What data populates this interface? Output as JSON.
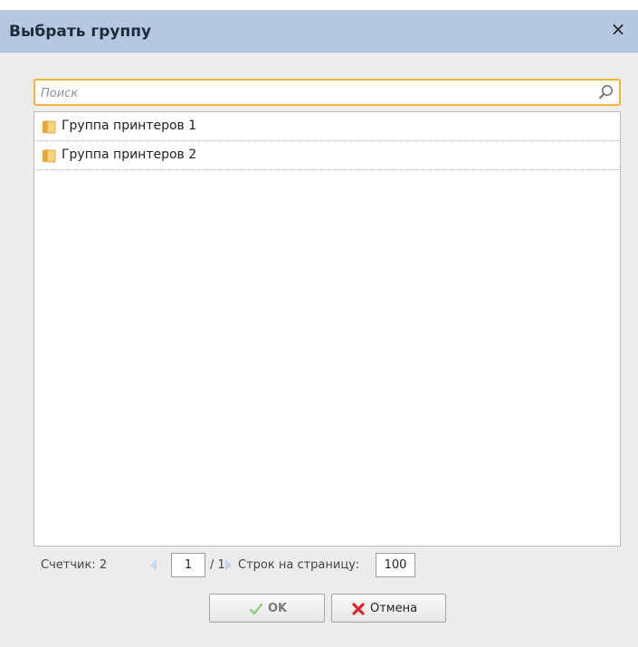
{
  "dialog": {
    "title": "Выбрать группу",
    "close_label": "×"
  },
  "search": {
    "placeholder": "Поиск",
    "value": ""
  },
  "list": {
    "items": [
      {
        "label": "Группа принтеров 1",
        "icon": "folder-icon"
      },
      {
        "label": "Группа принтеров 2",
        "icon": "folder-icon"
      }
    ]
  },
  "pager": {
    "counter_label": "Счетчик: 2",
    "page_value": "1",
    "total_label": "/ 1",
    "rows_label": "Строк на страницу:",
    "rows_value": "100"
  },
  "buttons": {
    "ok_label": "OK",
    "cancel_label": "Отмена"
  },
  "colors": {
    "header": "#b4c8e2",
    "search_border": "#f3b23b",
    "ok_check": "#8fd07a",
    "cancel_x": "#d8262a"
  }
}
